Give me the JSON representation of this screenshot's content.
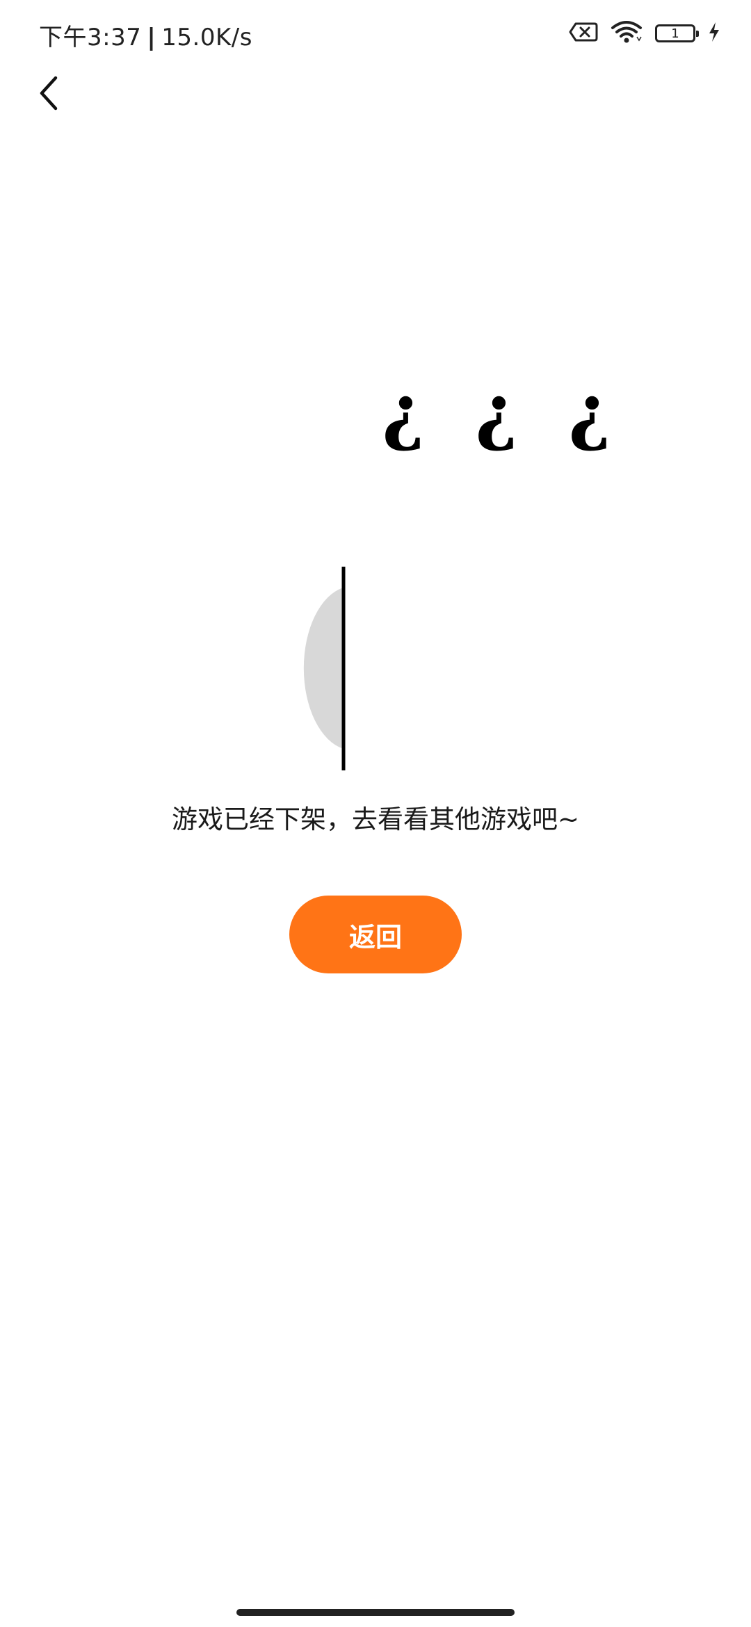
{
  "status_bar": {
    "time": "下午3:37",
    "network_speed": "15.0K/s",
    "battery_level": "1",
    "icons": [
      "sim-x-icon",
      "wifi-icon",
      "battery-icon",
      "charging-bolt-icon"
    ]
  },
  "nav": {
    "back_icon": "chevron-left-icon"
  },
  "illustration": {
    "glyphs": [
      "¿",
      "¿",
      "¿"
    ],
    "accent_gray": "#d8d8d8"
  },
  "message": "游戏已经下架，去看看其他游戏吧~",
  "actions": {
    "return_label": "返回",
    "return_color": "#ff7416"
  }
}
